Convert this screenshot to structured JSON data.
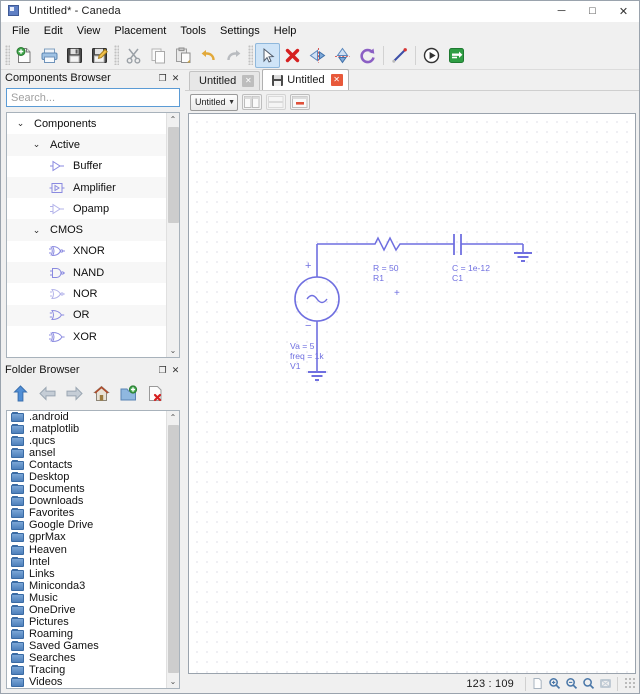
{
  "window": {
    "title": "Untitled* - Caneda",
    "app_icon": "app-icon",
    "minimize": "─",
    "maximize": "□",
    "close": "✕"
  },
  "menubar": {
    "items": [
      {
        "label": "File"
      },
      {
        "label": "Edit"
      },
      {
        "label": "View"
      },
      {
        "label": "Placement"
      },
      {
        "label": "Tools"
      },
      {
        "label": "Settings"
      },
      {
        "label": "Help"
      }
    ]
  },
  "toolbar": {
    "groups": [
      {
        "buttons": [
          {
            "name": "new-document-button",
            "icon": "new-file-icon",
            "title": "New"
          },
          {
            "name": "print-button",
            "icon": "printer-icon",
            "title": "Print"
          },
          {
            "name": "save-button",
            "icon": "floppy-save-icon",
            "title": "Save"
          },
          {
            "name": "save-as-button",
            "icon": "save-as-icon",
            "title": "Save As"
          }
        ]
      },
      {
        "buttons": [
          {
            "name": "cut-button",
            "icon": "scissors-icon",
            "title": "Cut"
          },
          {
            "name": "copy-button",
            "icon": "copy-icon",
            "title": "Copy"
          },
          {
            "name": "paste-button",
            "icon": "paste-icon",
            "title": "Paste"
          },
          {
            "name": "undo-button",
            "icon": "undo-arrow-icon",
            "title": "Undo"
          },
          {
            "name": "redo-button",
            "icon": "redo-arrow-icon",
            "title": "Redo"
          }
        ]
      },
      {
        "buttons": [
          {
            "name": "select-tool-button",
            "icon": "cursor-arrow-icon",
            "title": "Select",
            "active": true
          },
          {
            "name": "delete-button",
            "icon": "red-cross-icon",
            "title": "Delete"
          },
          {
            "name": "mirror-horizontal-button",
            "icon": "mirror-x-icon",
            "title": "Mirror X"
          },
          {
            "name": "mirror-vertical-button",
            "icon": "mirror-y-icon",
            "title": "Mirror Y"
          },
          {
            "name": "rotate-button",
            "icon": "rotate-icon",
            "title": "Rotate"
          },
          {
            "name": "wire-tool-button",
            "icon": "wire-line-icon",
            "title": "Insert wire"
          },
          {
            "name": "simulate-button",
            "icon": "play-circle-icon",
            "title": "Simulate"
          },
          {
            "name": "open-simulation-button",
            "icon": "green-export-icon",
            "title": "Open simulation"
          }
        ]
      }
    ]
  },
  "components_browser": {
    "title": "Components Browser",
    "float_button": "❐",
    "close_button": "✕",
    "search": {
      "placeholder": "Search...",
      "value": ""
    },
    "tree": [
      {
        "label": "Components",
        "depth": 0,
        "type": "group",
        "caret": "⌄"
      },
      {
        "label": "Active",
        "depth": 1,
        "type": "group",
        "caret": "⌄"
      },
      {
        "label": "Buffer",
        "depth": 2,
        "type": "item",
        "icon": "buffer-symbol-icon"
      },
      {
        "label": "Amplifier",
        "depth": 2,
        "type": "item",
        "icon": "amplifier-symbol-icon"
      },
      {
        "label": "Opamp",
        "depth": 2,
        "type": "item",
        "icon": "opamp-symbol-icon"
      },
      {
        "label": "CMOS",
        "depth": 1,
        "type": "group",
        "caret": "⌄"
      },
      {
        "label": "XNOR",
        "depth": 2,
        "type": "item",
        "icon": "xnor-gate-icon"
      },
      {
        "label": "NAND",
        "depth": 2,
        "type": "item",
        "icon": "nand-gate-icon"
      },
      {
        "label": "NOR",
        "depth": 2,
        "type": "item",
        "icon": "nor-gate-icon"
      },
      {
        "label": "OR",
        "depth": 2,
        "type": "item",
        "icon": "or-gate-icon"
      },
      {
        "label": "XOR",
        "depth": 2,
        "type": "item",
        "icon": "xor-gate-icon"
      }
    ],
    "scroll_up": "⌃",
    "scroll_down": "⌄"
  },
  "folder_browser": {
    "title": "Folder Browser",
    "float_button": "❐",
    "close_button": "✕",
    "toolbar": [
      {
        "name": "go-up-button",
        "icon": "up-arrow-icon"
      },
      {
        "name": "go-back-button",
        "icon": "back-arrow-icon"
      },
      {
        "name": "go-forward-button",
        "icon": "forward-arrow-icon"
      },
      {
        "name": "go-home-button",
        "icon": "home-icon"
      },
      {
        "name": "new-folder-button",
        "icon": "new-folder-icon"
      },
      {
        "name": "delete-file-button",
        "icon": "delete-file-icon"
      }
    ],
    "items": [
      ".android",
      ".matplotlib",
      ".qucs",
      "ansel",
      "Contacts",
      "Desktop",
      "Documents",
      "Downloads",
      "Favorites",
      "Google Drive",
      "gprMax",
      "Heaven",
      "Intel",
      "Links",
      "Miniconda3",
      "Music",
      "OneDrive",
      "Pictures",
      "Roaming",
      "Saved Games",
      "Searches",
      "Tracing",
      "Videos"
    ],
    "scroll_up": "⌃",
    "scroll_down": "⌄"
  },
  "document_area": {
    "tabs": [
      {
        "label": "Untitled",
        "selected": false,
        "close": "✕",
        "modified": false
      },
      {
        "label": "Untitled",
        "selected": true,
        "close": "✕",
        "modified": true,
        "icon": "floppy-save-icon"
      }
    ],
    "toolbar": {
      "select_value": "Untitled",
      "select_arrow": "▼",
      "buttons": [
        {
          "name": "split-vertical-button",
          "icon": "split-vertical-icon"
        },
        {
          "name": "split-horizontal-button",
          "icon": "split-horizontal-icon"
        },
        {
          "name": "close-split-button",
          "icon": "close-split-icon"
        }
      ]
    }
  },
  "schematic": {
    "accent_color": "#6f6fe0",
    "elements": [
      {
        "name": "voltage-source",
        "ref": "V1",
        "params": [
          "Va = 5",
          "freq = 1k",
          "V1"
        ]
      },
      {
        "name": "resistor",
        "ref": "R1",
        "params": [
          "R = 50",
          "R1"
        ]
      },
      {
        "name": "capacitor",
        "ref": "C1",
        "params": [
          "C = 1e-12",
          "C1"
        ]
      },
      {
        "name": "ground",
        "ref": "GND"
      }
    ],
    "labels": {
      "resistor_value": "R = 50",
      "resistor_name": "R1",
      "capacitor_value": "C = 1e-12",
      "capacitor_name": "C1",
      "source_amplitude": "Va = 5",
      "source_frequency": "freq = 1k",
      "source_name": "V1",
      "plus_source": "+",
      "minus_source": "−",
      "plus_node": "+"
    }
  },
  "statusbar": {
    "coordinates": "123 : 109",
    "buttons": [
      {
        "name": "fit-page-button",
        "icon": "page-fit-icon"
      },
      {
        "name": "zoom-in-button",
        "icon": "zoom-in-icon"
      },
      {
        "name": "zoom-out-button",
        "icon": "zoom-out-icon"
      },
      {
        "name": "zoom-reset-button",
        "icon": "zoom-reset-icon"
      },
      {
        "name": "zoom-fit-button",
        "icon": "zoom-fit-icon"
      }
    ],
    "resize_grip": "resize-grip-icon"
  }
}
